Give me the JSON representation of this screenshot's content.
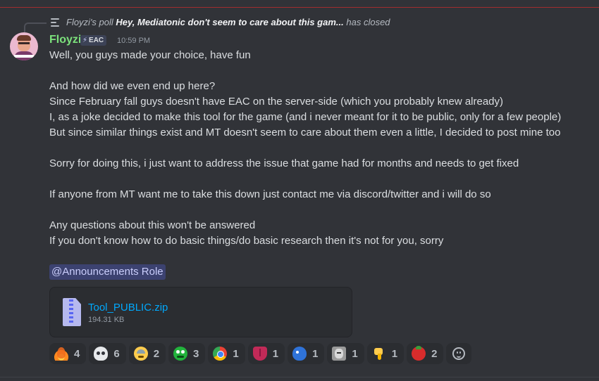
{
  "poll": {
    "author": "Floyzi's poll",
    "question": "Hey, Mediatonic don't seem to care about this gam...",
    "status": "has closed"
  },
  "message": {
    "username": "Floyzi",
    "tag": "EAC",
    "timestamp": "10:59 PM",
    "lines": [
      "Well, you guys made your choice, have fun",
      "And how did we even end up here?",
      "Since February fall guys doesn't have EAC on the server-side (which you probably knew already)",
      "I, as a joke decided to make this tool for the game (and i never meant for it to be public, only for a few people)",
      "But since similar things exist and MT doesn't seem to care about them even a little, I decided to post mine too",
      "Sorry for doing this, i just want to address the issue that game had for months and needs to get fixed",
      "If anyone from MT want me to take this down just contact me via discord/twitter and i will do so",
      "Any questions about this won't be answered",
      "If you don't know how to do basic things/do basic research then it's not for you, sorry"
    ],
    "mention": "@Announcements Role"
  },
  "attachment": {
    "filename": "Tool_PUBLIC.zip",
    "size": "194.31 KB"
  },
  "reactions": [
    {
      "icon": "fire-emoji",
      "count": "4"
    },
    {
      "icon": "skull-emoji",
      "count": "6"
    },
    {
      "icon": "sad-sweat-emoji",
      "count": "2"
    },
    {
      "icon": "green-face-emoji",
      "count": "3"
    },
    {
      "icon": "chrome-emoji",
      "count": "1"
    },
    {
      "icon": "tongue-emoji",
      "count": "1"
    },
    {
      "icon": "blue-creature-emoji",
      "count": "1"
    },
    {
      "icon": "face-photo-emoji",
      "count": "1"
    },
    {
      "icon": "thumbs-down-emoji",
      "count": "1"
    },
    {
      "icon": "tomato-emoji",
      "count": "2"
    }
  ],
  "colors": {
    "background": "#313338",
    "username": "#7ce27c",
    "link": "#00a8fc",
    "mention_bg": "#3c4270"
  }
}
